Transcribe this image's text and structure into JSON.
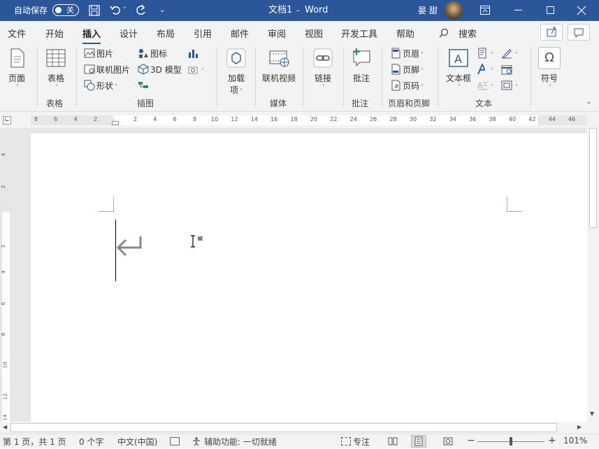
{
  "titlebar": {
    "autosave_label": "自动保存",
    "autosave_state": "关",
    "doc_title": "文档1",
    "separator": "-",
    "app_name": "Word",
    "user_name": "晏 甜"
  },
  "menu": {
    "tabs": [
      "文件",
      "开始",
      "插入",
      "设计",
      "布局",
      "引用",
      "邮件",
      "审阅",
      "视图",
      "开发工具",
      "帮助"
    ],
    "active_tab": "插入",
    "search_label": "搜索"
  },
  "ribbon": {
    "pages": {
      "label": "页面"
    },
    "tables": {
      "button": "表格",
      "group": "表格"
    },
    "illustrations": {
      "group": "插图",
      "pictures": "图片",
      "online_pictures": "联机图片",
      "shapes": "形状",
      "icons": "图标",
      "models": "3D 模型"
    },
    "addins": {
      "label_line1": "加载",
      "label_line2": "项"
    },
    "media": {
      "online_video": "联机视频",
      "group": "媒体"
    },
    "links": {
      "label": "链接"
    },
    "comments": {
      "button": "批注",
      "group": "批注"
    },
    "header_footer": {
      "header": "页眉",
      "footer": "页脚",
      "page_number": "页码",
      "group": "页眉和页脚"
    },
    "text": {
      "textbox_line1": "文本框",
      "group": "文本"
    },
    "symbols": {
      "label": "符号",
      "omega": "Ω"
    }
  },
  "ruler": {
    "ticks": [
      "8",
      "6",
      "4",
      "2",
      "2",
      "4",
      "6",
      "8",
      "10",
      "12",
      "14",
      "16",
      "18",
      "20",
      "22",
      "24",
      "26",
      "28",
      "30",
      "32",
      "34",
      "36",
      "38",
      "40",
      "42",
      "44",
      "46"
    ],
    "vticks": [
      "4",
      "2",
      "2",
      "4",
      "6",
      "8",
      "10",
      "12",
      "14"
    ]
  },
  "statusbar": {
    "page": "第 1 页，共 1 页",
    "words": "0 个字",
    "language": "中文(中国)",
    "accessibility": "辅助功能: 一切就绪",
    "focus": "专注",
    "zoom": "101%"
  },
  "colors": {
    "brand": "#2b579a",
    "ribbon_bg": "#f3f3f3",
    "canvas_bg": "#e6e6e6"
  }
}
